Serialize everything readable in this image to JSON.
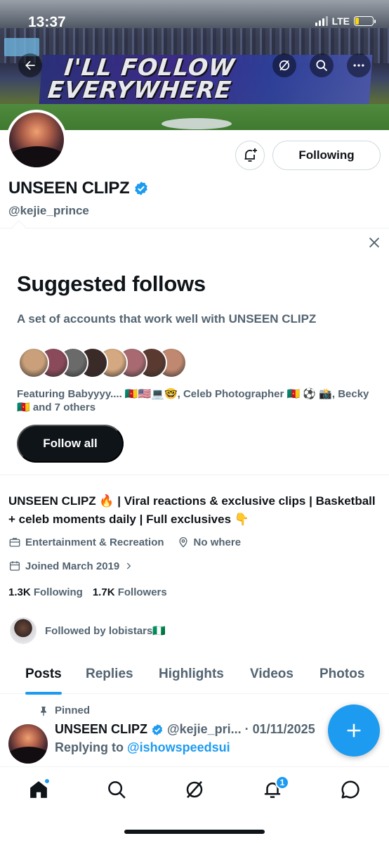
{
  "status_bar": {
    "time": "13:37",
    "network": "LTE",
    "battery_level": 0.22
  },
  "banner": {
    "tifo_line1": "I'LL FOLLOW",
    "tifo_line2": "EVERYWHERE",
    "icons": [
      "back-arrow-icon",
      "grok-icon",
      "search-icon",
      "more-icon"
    ]
  },
  "profile": {
    "name": "UNSEEN CLIPZ",
    "handle": "@kejie_prince",
    "verified": true,
    "following_button": "Following"
  },
  "suggested": {
    "title": "Suggested follows",
    "subtitle": "A set of accounts that work well with UNSEEN CLIPZ",
    "featuring": "Featuring Babyyyy.... 🇨🇲🇺🇸💻🤓, Celeb Photographer 🇨🇲 ⚽ 📸, Becky🇨🇲 and 7 others",
    "follow_all": "Follow all",
    "face_colors": [
      "#c9a07a",
      "#8a4a5a",
      "#6a6a6a",
      "#3a2a28",
      "#d4a880",
      "#a86a70",
      "#5a3a30",
      "#c08870"
    ]
  },
  "bio": {
    "text": "UNSEEN CLIPZ 🔥 | Viral reactions & exclusive clips | Basketball + celeb moments daily | Full exclusives 👇",
    "category": "Entertainment & Recreation",
    "location": "No where",
    "joined": "Joined March 2019"
  },
  "stats": {
    "following_count": "1.3K",
    "following_label": "Following",
    "followers_count": "1.7K",
    "followers_label": "Followers"
  },
  "followed_by": "Followed by lobistars🇳🇬",
  "tabs": [
    {
      "label": "Posts",
      "active": true
    },
    {
      "label": "Replies",
      "active": false
    },
    {
      "label": "Highlights",
      "active": false
    },
    {
      "label": "Videos",
      "active": false
    },
    {
      "label": "Photos",
      "active": false
    }
  ],
  "pinned_post": {
    "pinned_label": "Pinned",
    "name": "UNSEEN CLIPZ",
    "handle_date": "@kejie_pri... · 01/11/2025",
    "replying_prefix": "Replying to",
    "replying_to": "@ishowspeedsui"
  },
  "bottom_nav": {
    "items": [
      "home-icon",
      "search-icon",
      "grok-icon",
      "notifications-icon",
      "messages-icon"
    ],
    "notification_count": "1"
  },
  "colors": {
    "accent": "#1d9bf0",
    "text": "#0f1419",
    "secondary": "#536471"
  }
}
